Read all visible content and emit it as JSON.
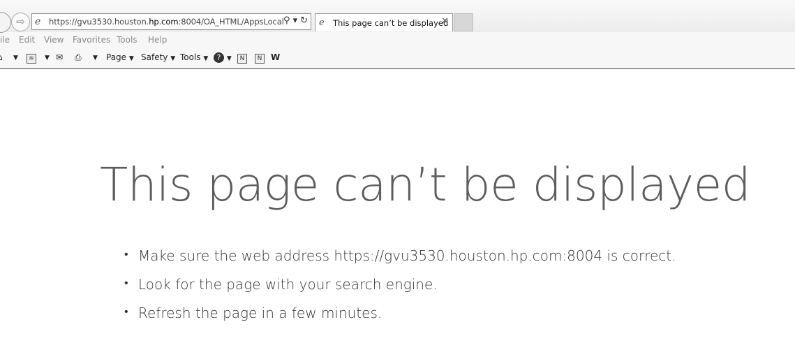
{
  "browser": {
    "address_bar": {
      "url_prefix": "https://gvu3530.houston.",
      "url_domain": "hp.com",
      "url_suffix": ":8004/OA_HTML/AppsLocal"
    },
    "tab": {
      "title": "This page can’t be displayed"
    },
    "menu": [
      "ile",
      "Edit",
      "View",
      "Favorites",
      "Tools",
      "Help"
    ],
    "command_bar": {
      "page_label": "Page",
      "safety_label": "Safety",
      "tools_label": "Tools"
    }
  },
  "error_page": {
    "heading": "This page can’t be displayed",
    "tips": [
      "Make sure the web address https://gvu3530.houston.hp.com:8004 is correct.",
      "Look for the page with your search engine.",
      "Refresh the page in a few minutes."
    ]
  }
}
